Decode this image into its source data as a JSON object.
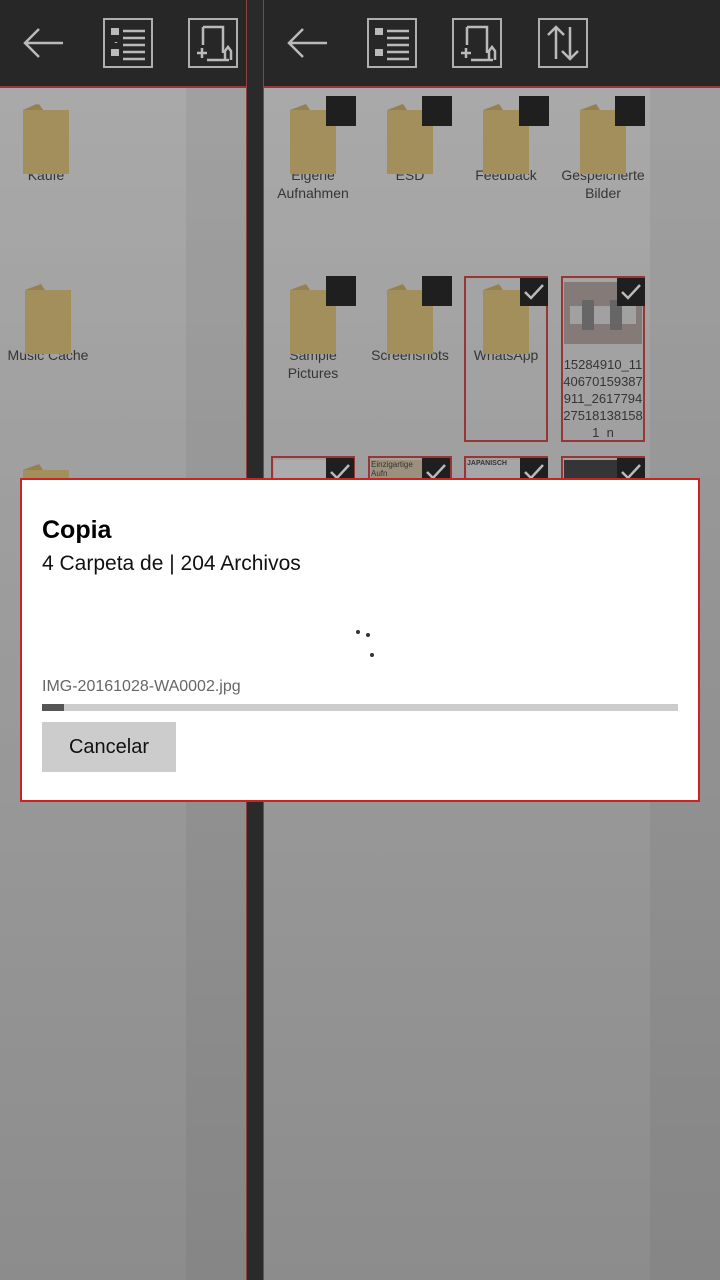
{
  "left_pane": {
    "items": [
      {
        "label": "Käufe"
      },
      {
        "label": "Music Cache"
      }
    ]
  },
  "right_pane": {
    "items": [
      {
        "label": "Eigene Aufnahmen"
      },
      {
        "label": "ESD"
      },
      {
        "label": "Feedback"
      },
      {
        "label": "Gespeicherte Bilder"
      },
      {
        "label": "Sample Pictures"
      },
      {
        "label": "Screenshots"
      },
      {
        "label": "WhatsApp"
      },
      {
        "label": "15284910_1140670159387911_2617794275181381581_n"
      }
    ],
    "row3_thumb_texts": [
      "",
      "Einzigartige Aufn",
      "JAPANISCH",
      ""
    ]
  },
  "dialog": {
    "title": "Copia",
    "subtitle": "4 Carpeta de | 204 Archivos",
    "filename": "IMG-20161028-WA0002.jpg",
    "progress_fraction": 0.035,
    "cancel_label": "Cancelar"
  },
  "icons": [
    "back-arrow-icon",
    "list-view-icon",
    "new-folder-icon",
    "sort-icon",
    "folder-icon",
    "checkmark-icon"
  ],
  "colors": {
    "accent": "#bb2222",
    "toolbar": "#0d0d0d",
    "folder": "#c9ad5e"
  }
}
